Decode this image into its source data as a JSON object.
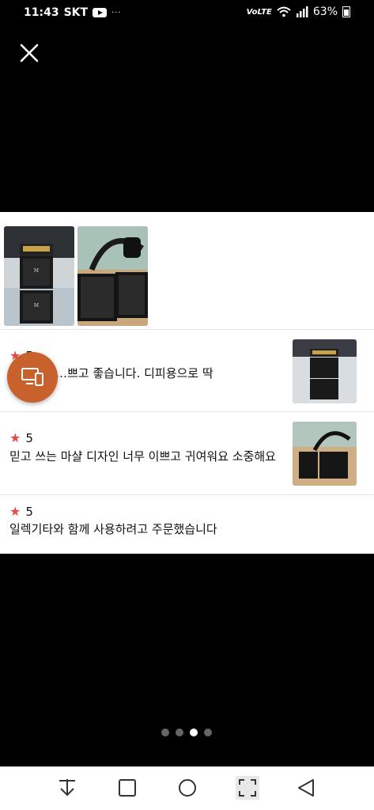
{
  "status_bar": {
    "time": "11:43",
    "carrier": "SKT",
    "more": "···",
    "network": "VoLTE",
    "battery": "63%"
  },
  "reviews": [
    {
      "star": "★",
      "score": "5",
      "text": "…쁘고 좋습니다. 디피용으로 딱"
    },
    {
      "star": "★",
      "score": "5",
      "text": "믿고 쓰는 마샬 디자인 너무 이쁘고 귀여워요 소중해요"
    },
    {
      "star": "★",
      "score": "5",
      "text": "일렉기타와 함께 사용하려고 주문했습니다"
    }
  ],
  "pager": {
    "count": 4,
    "active_index": 2
  },
  "colors": {
    "accent": "#c8612b",
    "star": "#e84a4a"
  },
  "icons": {
    "close": "close-icon",
    "fab": "devices-icon",
    "nav_download": "download-icon",
    "nav_recents": "square-icon",
    "nav_home": "circle-icon",
    "nav_capture": "screen-capture-icon",
    "nav_back": "back-triangle-icon"
  }
}
